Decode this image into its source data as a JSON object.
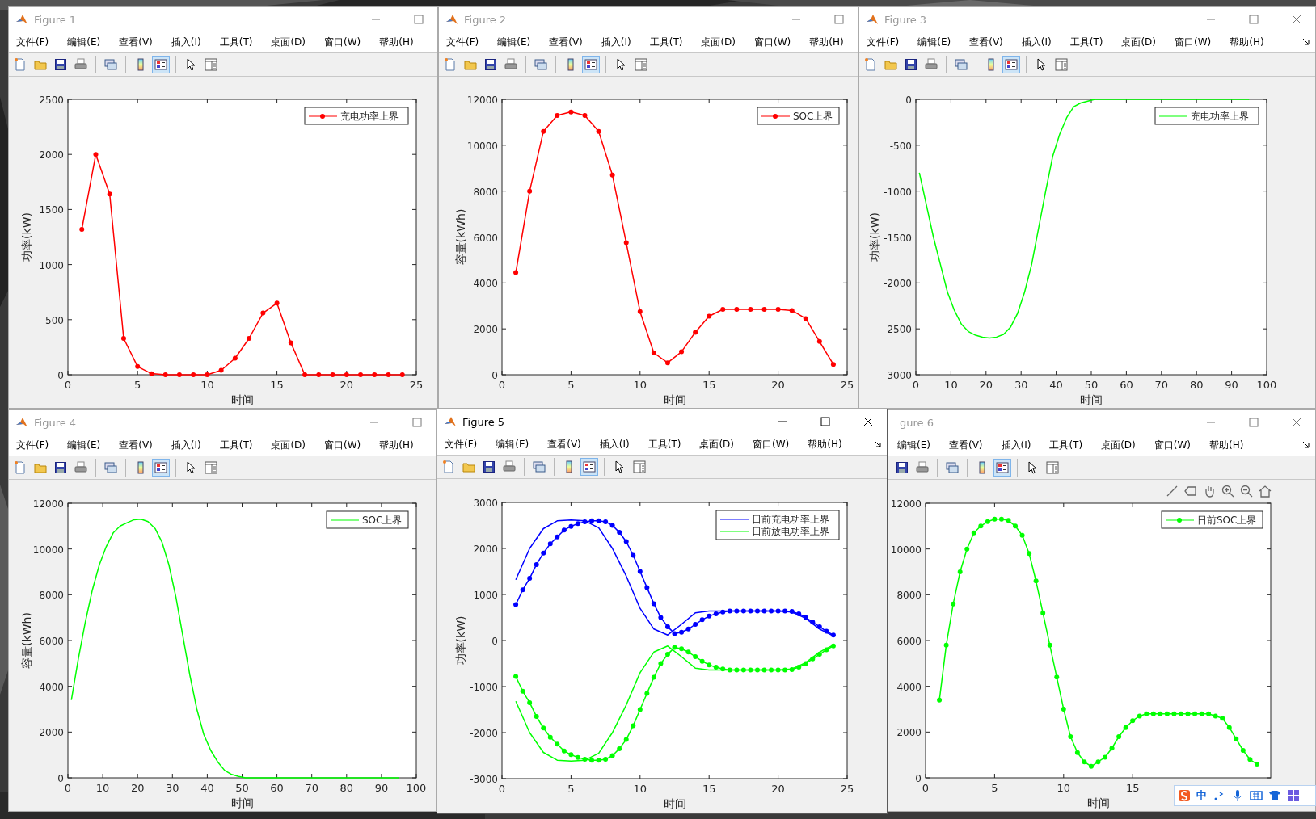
{
  "windows": [
    {
      "title": "Figure 1",
      "active": false,
      "menu": [
        "文件(F)",
        "编辑(E)",
        "查看(V)",
        "插入(I)",
        "工具(T)",
        "桌面(D)",
        "窗口(W)",
        "帮助(H)"
      ],
      "chart_data": {
        "type": "line",
        "xlabel": "时间",
        "ylabel": "功率(kW)",
        "xlim": [
          0,
          25
        ],
        "ylim": [
          0,
          2500
        ],
        "legend": "upper right",
        "xticks": [
          0,
          5,
          10,
          15,
          20,
          25
        ],
        "yticks": [
          0,
          500,
          1000,
          1500,
          2000,
          2500
        ],
        "series": [
          {
            "name": "充电功率上界",
            "color": "#ff0000",
            "marker": "circle",
            "x": [
              1,
              2,
              3,
              4,
              5,
              6,
              7,
              8,
              9,
              10,
              11,
              12,
              13,
              14,
              15,
              16,
              17,
              18,
              19,
              20,
              21,
              22,
              23,
              24
            ],
            "values": [
              1320,
              2000,
              1640,
              330,
              75,
              10,
              0,
              0,
              0,
              0,
              40,
              150,
              330,
              560,
              650,
              290,
              0,
              0,
              0,
              0,
              0,
              0,
              0,
              0
            ]
          }
        ]
      }
    },
    {
      "title": "Figure 2",
      "active": false,
      "menu": [
        "文件(F)",
        "编辑(E)",
        "查看(V)",
        "插入(I)",
        "工具(T)",
        "桌面(D)",
        "窗口(W)",
        "帮助(H)"
      ],
      "chart_data": {
        "type": "line",
        "xlabel": "时间",
        "ylabel": "容量(kWh)",
        "xlim": [
          0,
          25
        ],
        "legend": "upper right",
        "ylim": [
          0,
          12000
        ],
        "xticks": [
          0,
          5,
          10,
          15,
          20,
          25
        ],
        "yticks": [
          0,
          2000,
          4000,
          6000,
          8000,
          10000,
          12000
        ],
        "series": [
          {
            "name": "SOC上界",
            "color": "#ff0000",
            "marker": "circle",
            "x": [
              1,
              2,
              3,
              4,
              5,
              6,
              7,
              8,
              9,
              10,
              11,
              12,
              13,
              14,
              15,
              16,
              17,
              18,
              19,
              20,
              21,
              22,
              23,
              24
            ],
            "values": [
              4450,
              8000,
              10600,
              11300,
              11450,
              11300,
              10600,
              8700,
              5750,
              2750,
              950,
              520,
              1000,
              1850,
              2550,
              2850,
              2850,
              2850,
              2850,
              2850,
              2800,
              2450,
              1450,
              450
            ]
          }
        ]
      }
    },
    {
      "title": "Figure 3",
      "active": false,
      "menu": [
        "文件(F)",
        "编辑(E)",
        "查看(V)",
        "插入(I)",
        "工具(T)",
        "桌面(D)",
        "窗口(W)",
        "帮助(H)"
      ],
      "chart_data": {
        "type": "line",
        "xlabel": "时间",
        "ylabel": "功率(kW)",
        "xlim": [
          0,
          100
        ],
        "ylim": [
          -3000,
          0
        ],
        "legend": "upper right",
        "xticks": [
          0,
          10,
          20,
          30,
          40,
          50,
          60,
          70,
          80,
          90,
          100
        ],
        "yticks": [
          -3000,
          -2500,
          -2000,
          -1500,
          -1000,
          -500,
          0
        ],
        "series": [
          {
            "name": "充电功率上界",
            "color": "#00ff00",
            "marker": "none",
            "x": [
              1,
              3,
              5,
              7,
              9,
              11,
              13,
              15,
              17,
              19,
              21,
              23,
              25,
              27,
              29,
              31,
              33,
              35,
              37,
              39,
              41,
              43,
              45,
              47,
              49,
              51,
              53,
              55,
              57,
              59,
              61,
              63,
              65,
              67,
              69,
              71,
              73,
              75,
              77,
              79,
              81,
              83,
              85,
              87,
              89,
              91,
              93,
              95
            ],
            "values": [
              -800,
              -1150,
              -1500,
              -1800,
              -2100,
              -2300,
              -2450,
              -2530,
              -2570,
              -2590,
              -2600,
              -2590,
              -2560,
              -2480,
              -2330,
              -2100,
              -1800,
              -1400,
              -1000,
              -620,
              -380,
              -200,
              -80,
              -40,
              -20,
              0,
              0,
              0,
              0,
              0,
              0,
              0,
              0,
              0,
              0,
              0,
              0,
              0,
              0,
              0,
              0,
              0,
              0,
              0,
              0,
              0,
              0,
              0
            ]
          }
        ]
      }
    },
    {
      "title": "Figure 4",
      "active": false,
      "menu": [
        "文件(F)",
        "编辑(E)",
        "查看(V)",
        "插入(I)",
        "工具(T)",
        "桌面(D)",
        "窗口(W)",
        "帮助(H)"
      ],
      "chart_data": {
        "type": "line",
        "xlabel": "时间",
        "ylabel": "容量(kWh)",
        "xlim": [
          0,
          100
        ],
        "legend": "upper right",
        "ylim": [
          0,
          12000
        ],
        "xticks": [
          0,
          10,
          20,
          30,
          40,
          50,
          60,
          70,
          80,
          90,
          100
        ],
        "yticks": [
          0,
          2000,
          4000,
          6000,
          8000,
          10000,
          12000
        ],
        "series": [
          {
            "name": "SOC上界",
            "color": "#00ff00",
            "marker": "none",
            "x": [
              1,
              3,
              5,
              7,
              9,
              11,
              13,
              15,
              17,
              19,
              21,
              23,
              25,
              27,
              29,
              31,
              33,
              35,
              37,
              39,
              41,
              43,
              45,
              47,
              49,
              51,
              53,
              55,
              57,
              59,
              61,
              63,
              65,
              67,
              69,
              71,
              73,
              75,
              77,
              79,
              81,
              83,
              85,
              87,
              89,
              91,
              93,
              95
            ],
            "values": [
              3400,
              5200,
              6800,
              8200,
              9300,
              10100,
              10700,
              11000,
              11150,
              11280,
              11300,
              11200,
              10900,
              10300,
              9300,
              7900,
              6200,
              4500,
              3000,
              1900,
              1200,
              700,
              320,
              150,
              60,
              0,
              0,
              0,
              0,
              0,
              0,
              0,
              0,
              0,
              0,
              0,
              0,
              0,
              0,
              0,
              0,
              0,
              0,
              0,
              0,
              0,
              0,
              0
            ]
          }
        ]
      }
    },
    {
      "title": "Figure 5",
      "active": true,
      "menu": [
        "文件(F)",
        "编辑(E)",
        "查看(V)",
        "插入(I)",
        "工具(T)",
        "桌面(D)",
        "窗口(W)",
        "帮助(H)"
      ],
      "chart_data": {
        "type": "line",
        "xlabel": "时间",
        "ylabel": "功率(kW)",
        "xlim": [
          0,
          25
        ],
        "ylim": [
          -3000,
          3000
        ],
        "legend": "upper right",
        "xticks": [
          0,
          5,
          10,
          15,
          20,
          25
        ],
        "yticks": [
          -3000,
          -2000,
          -1000,
          0,
          1000,
          2000,
          3000
        ],
        "series": [
          {
            "name": "日前充电功率上界",
            "color": "#0000ff",
            "marker": "none",
            "x": [
              1,
              2,
              3,
              4,
              5,
              6,
              7,
              8,
              9,
              10,
              11,
              12,
              13,
              14,
              15,
              16,
              17,
              18,
              19,
              20,
              21,
              22,
              23,
              24
            ],
            "values": [
              1320,
              2000,
              2430,
              2600,
              2620,
              2600,
              2450,
              2000,
              1400,
              700,
              250,
              120,
              350,
              600,
              640,
              640,
              640,
              640,
              640,
              640,
              620,
              480,
              250,
              100
            ]
          },
          {
            "color": "#0000ff",
            "marker": "circle",
            "x": [
              1,
              1.5,
              2,
              2.5,
              3,
              3.5,
              4,
              4.5,
              5,
              5.5,
              6,
              6.5,
              7,
              7.5,
              8,
              8.5,
              9,
              9.5,
              10,
              10.5,
              11,
              11.5,
              12,
              12.5,
              13,
              13.5,
              14,
              14.5,
              15,
              15.5,
              16,
              16.5,
              17,
              17.5,
              18,
              18.5,
              19,
              19.5,
              20,
              20.5,
              21,
              21.5,
              22,
              22.5,
              23,
              23.5,
              24
            ],
            "values": [
              780,
              1100,
              1350,
              1650,
              1900,
              2100,
              2250,
              2400,
              2480,
              2540,
              2580,
              2600,
              2600,
              2580,
              2500,
              2350,
              2150,
              1850,
              1500,
              1150,
              800,
              500,
              300,
              150,
              180,
              250,
              350,
              450,
              530,
              580,
              620,
              640,
              640,
              640,
              640,
              640,
              640,
              640,
              640,
              640,
              630,
              580,
              500,
              400,
              300,
              200,
              120
            ]
          },
          {
            "name": "日前放电功率上界",
            "color": "#00ff00",
            "marker": "none",
            "x": [
              1,
              2,
              3,
              4,
              5,
              6,
              7,
              8,
              9,
              10,
              11,
              12,
              13,
              14,
              15,
              16,
              17,
              18,
              19,
              20,
              21,
              22,
              23,
              24
            ],
            "values": [
              -1320,
              -2000,
              -2430,
              -2600,
              -2620,
              -2600,
              -2450,
              -2000,
              -1400,
              -700,
              -250,
              -120,
              -350,
              -600,
              -640,
              -640,
              -640,
              -640,
              -640,
              -640,
              -620,
              -480,
              -250,
              -100
            ]
          },
          {
            "color": "#00ff00",
            "marker": "circle",
            "x": [
              1,
              1.5,
              2,
              2.5,
              3,
              3.5,
              4,
              4.5,
              5,
              5.5,
              6,
              6.5,
              7,
              7.5,
              8,
              8.5,
              9,
              9.5,
              10,
              10.5,
              11,
              11.5,
              12,
              12.5,
              13,
              13.5,
              14,
              14.5,
              15,
              15.5,
              16,
              16.5,
              17,
              17.5,
              18,
              18.5,
              19,
              19.5,
              20,
              20.5,
              21,
              21.5,
              22,
              22.5,
              23,
              23.5,
              24
            ],
            "values": [
              -780,
              -1100,
              -1350,
              -1650,
              -1900,
              -2100,
              -2250,
              -2400,
              -2480,
              -2540,
              -2580,
              -2600,
              -2600,
              -2580,
              -2500,
              -2350,
              -2150,
              -1850,
              -1500,
              -1150,
              -800,
              -500,
              -300,
              -150,
              -180,
              -250,
              -350,
              -450,
              -530,
              -580,
              -620,
              -640,
              -640,
              -640,
              -640,
              -640,
              -640,
              -640,
              -640,
              -640,
              -630,
              -580,
              -500,
              -400,
              -300,
              -200,
              -120
            ]
          }
        ]
      }
    },
    {
      "title": "gure 6",
      "active": false,
      "menu": [
        "编辑(E)",
        "查看(V)",
        "插入(I)",
        "工具(T)",
        "桌面(D)",
        "窗口(W)",
        "帮助(H)"
      ],
      "chart_data": {
        "type": "line",
        "xlim": [
          0,
          25
        ],
        "ylim": [
          0,
          12000
        ],
        "xlabel": "时间",
        "xticks": [
          0,
          5,
          10,
          15
        ],
        "yticks": [
          0,
          2000,
          4000,
          6000,
          8000,
          10000,
          12000
        ],
        "legend": "upper right",
        "series": [
          {
            "name": "日前SOC上界",
            "color": "#00ff00",
            "marker": "circle",
            "x": [
              1,
              1.5,
              2,
              2.5,
              3,
              3.5,
              4,
              4.5,
              5,
              5.5,
              6,
              6.5,
              7,
              7.5,
              8,
              8.5,
              9,
              9.5,
              10,
              10.5,
              11,
              11.5,
              12,
              12.5,
              13,
              13.5,
              14,
              14.5,
              15,
              15.5,
              16,
              16.5,
              17,
              17.5,
              18,
              18.5,
              19,
              19.5,
              20,
              20.5,
              21,
              21.5,
              22,
              22.5,
              23,
              23.5,
              24
            ],
            "values": [
              3400,
              5800,
              7600,
              9000,
              10000,
              10700,
              11000,
              11200,
              11300,
              11300,
              11250,
              11000,
              10600,
              9800,
              8600,
              7200,
              5800,
              4400,
              3000,
              1800,
              1100,
              700,
              500,
              700,
              900,
              1300,
              1800,
              2200,
              2500,
              2700,
              2800,
              2800,
              2800,
              2800,
              2800,
              2800,
              2800,
              2800,
              2800,
              2800,
              2700,
              2600,
              2200,
              1700,
              1200,
              800,
              600
            ]
          }
        ]
      }
    }
  ],
  "ime": {
    "mode": "中"
  }
}
